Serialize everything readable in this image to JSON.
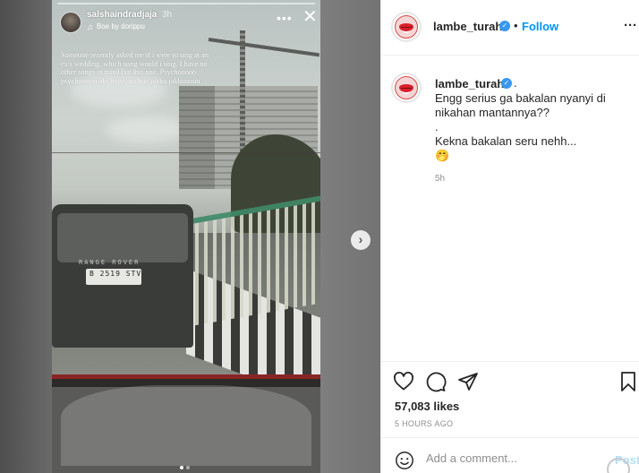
{
  "story": {
    "username": "salshaindradjaja",
    "time_ago": "3h",
    "music_icon": "music-note-icon",
    "music": "Boe by dorippu",
    "caption": "Someone recently asked me if i were to sing at an ex's wedding, which song would i sing. I have no other songs in mind but this one. Psychooooo psychooooo ulil bogo malhae jakku jakkuuuuu",
    "more_label": "•••",
    "close_label": "✕",
    "car_brand": "RANGE ROVER",
    "plate": "B 2519 STV"
  },
  "media": {
    "next_label": "›",
    "carousel_dots": 2,
    "active_dot": 0
  },
  "header": {
    "username": "lambe_turah",
    "verified_mark": "✓",
    "separator": "•",
    "follow_label": "Follow",
    "more_label": "···"
  },
  "comment": {
    "username": "lambe_turah",
    "verified_mark": "✓",
    "after_badge": ".",
    "lines": [
      "Engg serius ga bakalan nyanyi di nikahan mantannya??",
      ".",
      "Kekna bakalan seru nehh...",
      "🤭"
    ],
    "time_ago": "5h"
  },
  "actions": {
    "icons": [
      "heart-icon",
      "comment-icon",
      "share-icon",
      "bookmark-icon"
    ],
    "likes": "57,083 likes",
    "posted": "5 HOURS AGO"
  },
  "add_comment": {
    "placeholder": "Add a comment...",
    "post_label": "Post"
  },
  "colors": {
    "accent": "#0095f6",
    "verified": "#3897f0",
    "post_disabled": "#b2dffc",
    "logo_lips": "#d8202a"
  }
}
